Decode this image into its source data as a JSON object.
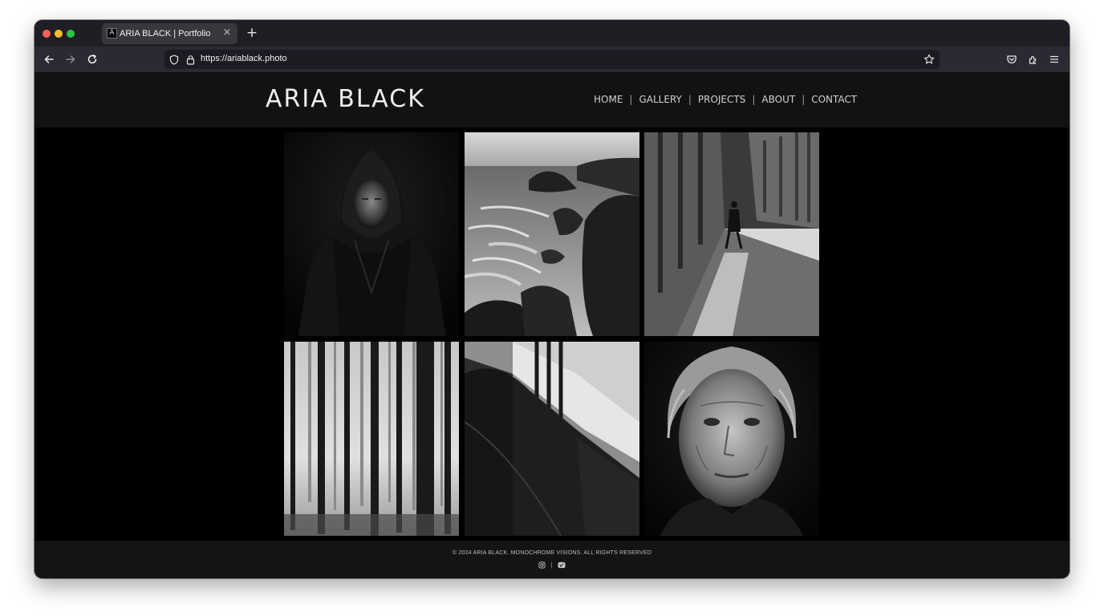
{
  "browser": {
    "tab": {
      "favicon_glyph": "A",
      "title": "ARIA BLACK | Portfolio",
      "close_glyph": "×"
    },
    "new_tab_glyph": "+",
    "url": "https://ariablack.photo",
    "icons": {
      "back": "arrow-left-icon",
      "forward": "arrow-right-icon",
      "reload": "reload-icon",
      "tracking": "shield-icon",
      "lock": "lock-icon",
      "bookmark": "star-icon",
      "pocket": "pocket-icon",
      "extensions": "puzzle-icon",
      "menu": "hamburger-menu-icon"
    },
    "colors": {
      "close": "#fe5f57",
      "minimize": "#febc2e",
      "zoom": "#28c840"
    }
  },
  "site": {
    "logo": "ARIA BLACK",
    "nav": [
      {
        "label": "HOME"
      },
      {
        "label": "GALLERY"
      },
      {
        "label": "PROJECTS"
      },
      {
        "label": "ABOUT"
      },
      {
        "label": "CONTACT"
      }
    ],
    "nav_separator": "|",
    "gallery": [
      {
        "subject": "hooded-figure-portrait"
      },
      {
        "subject": "rocky-coastline"
      },
      {
        "subject": "street-walker"
      },
      {
        "subject": "misty-forest"
      },
      {
        "subject": "architecture-shadow"
      },
      {
        "subject": "elderly-woman-portrait"
      }
    ],
    "footer": {
      "copyright": "© 2024 ARIA BLACK. MONOCHROME VISIONS. ALL RIGHTS RESERVED",
      "social_separator": "|",
      "socials": [
        "instagram-icon",
        "vimeo-icon"
      ]
    },
    "colors": {
      "header_bg": "#121212",
      "page_bg": "#000000",
      "text": "#efefef"
    }
  }
}
